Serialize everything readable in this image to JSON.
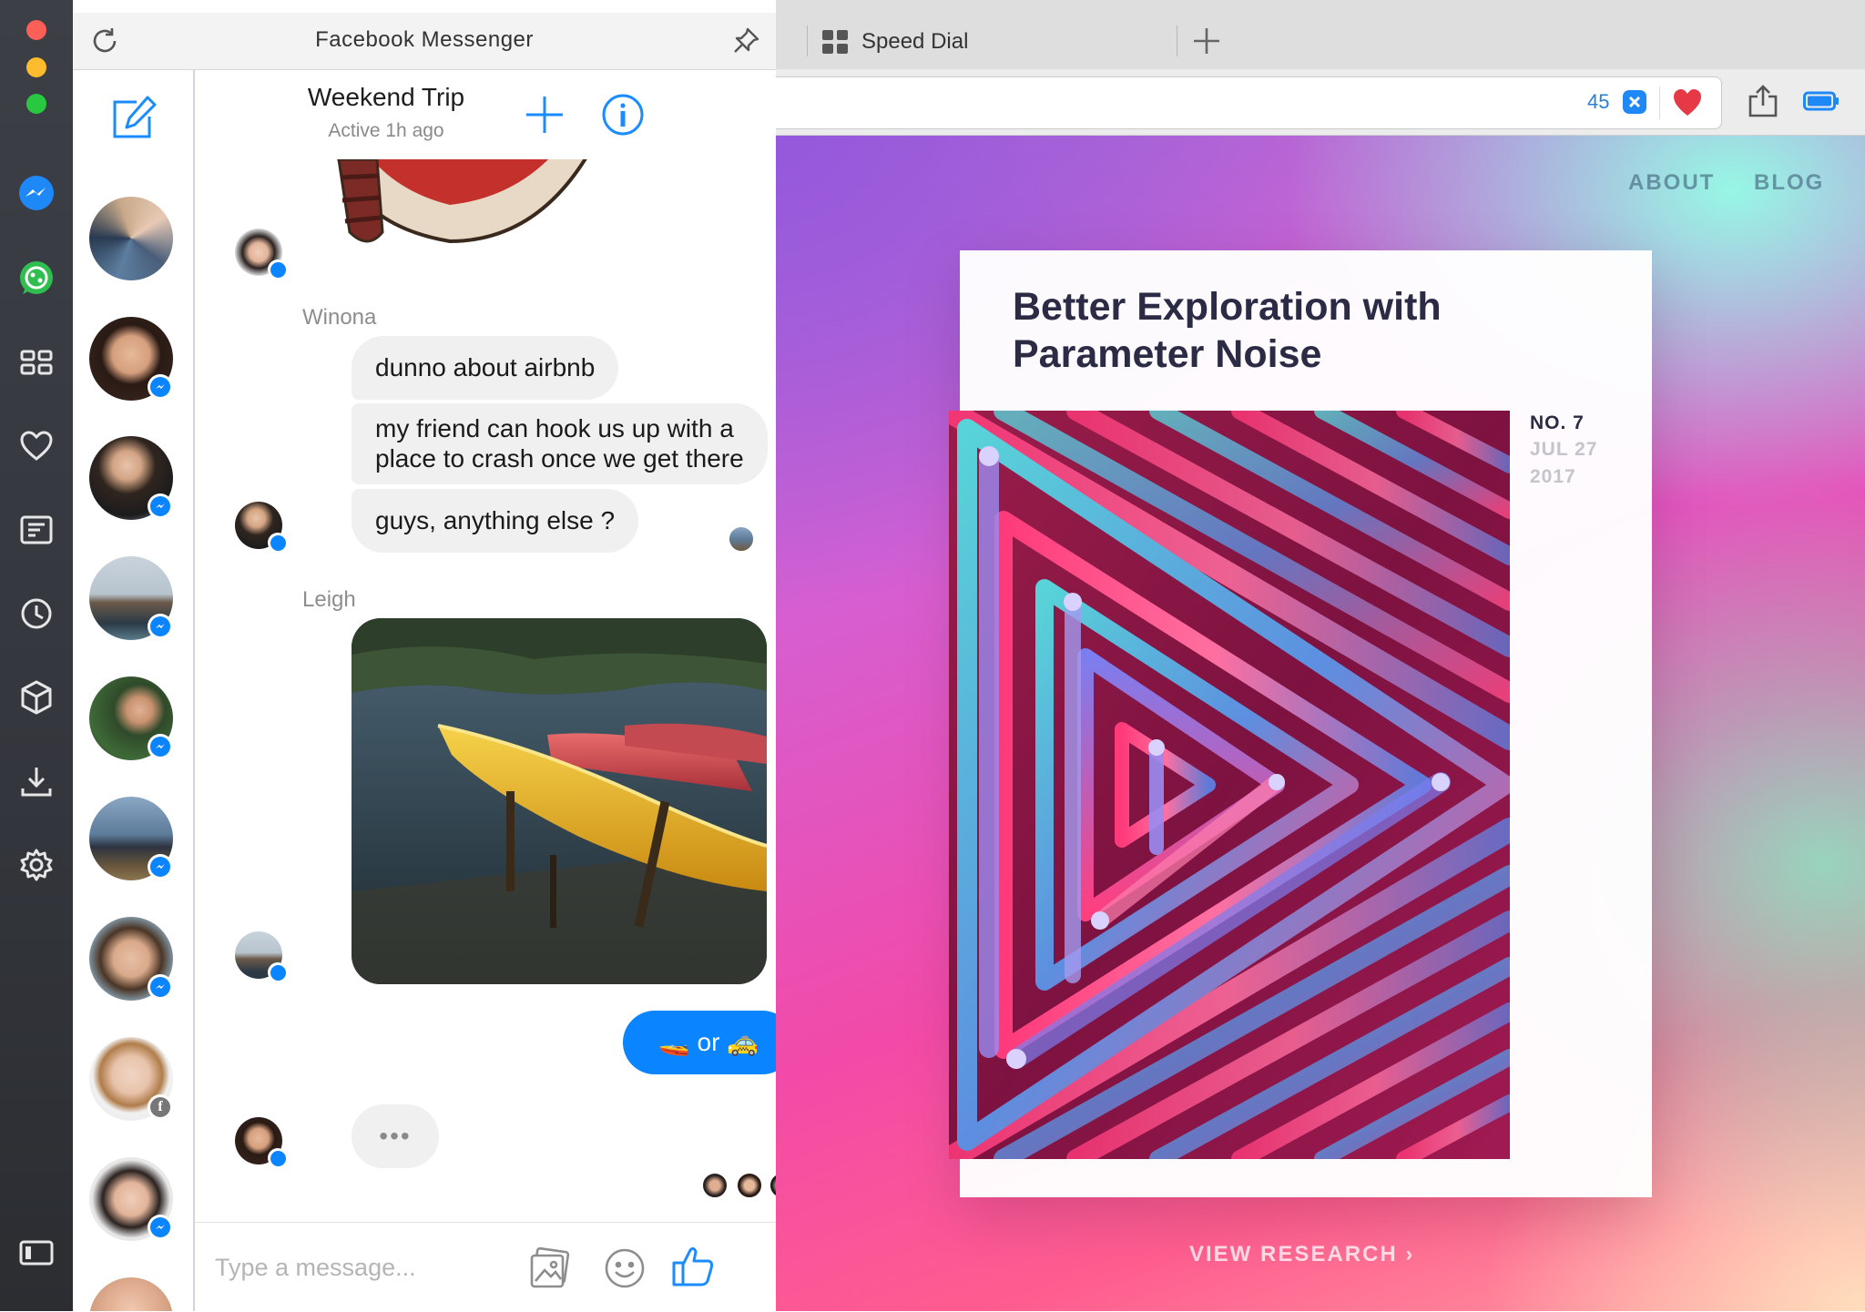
{
  "messenger": {
    "window_title": "Facebook Messenger",
    "conversation": {
      "name": "Weekend Trip",
      "status": "Active 1h ago"
    },
    "messages": {
      "sender_winona": "Winona",
      "bubble_1": "dunno about airbnb",
      "bubble_2_line1": "my friend can hook us up with a",
      "bubble_2_line2": "place to crash once we get there",
      "bubble_3": "guys, anything else ?",
      "sender_leigh": "Leigh",
      "sent_bubble": "🚤 or 🚕",
      "typing": "•••"
    },
    "compose": {
      "placeholder": "Type a message..."
    }
  },
  "browser": {
    "tab_title": "Speed Dial",
    "badge_count": "45"
  },
  "webpage": {
    "nav": {
      "about": "ABOUT",
      "blog": "BLOG"
    },
    "card": {
      "title": "Better Exploration with Parameter Noise",
      "number": "NO. 7",
      "date_line1": "JUL 27",
      "date_line2": "2017"
    },
    "view_research": "VIEW RESEARCH ›"
  },
  "colors": {
    "messenger_blue": "#0a84ff",
    "heart_red": "#e63946",
    "card_title": "#2b2b45"
  },
  "icons": [
    "refresh-icon",
    "pin-icon",
    "compose-icon",
    "add-people-icon",
    "info-icon",
    "messenger-icon",
    "whatsapp-icon",
    "speed-dial-icon",
    "heart-icon",
    "news-icon",
    "history-icon",
    "extensions-icon",
    "download-icon",
    "settings-icon",
    "sidebar-toggle-icon",
    "gallery-icon",
    "emoji-icon",
    "thumbs-up-icon",
    "share-icon",
    "battery-icon",
    "speed-dial-tab-icon",
    "new-tab-icon"
  ]
}
